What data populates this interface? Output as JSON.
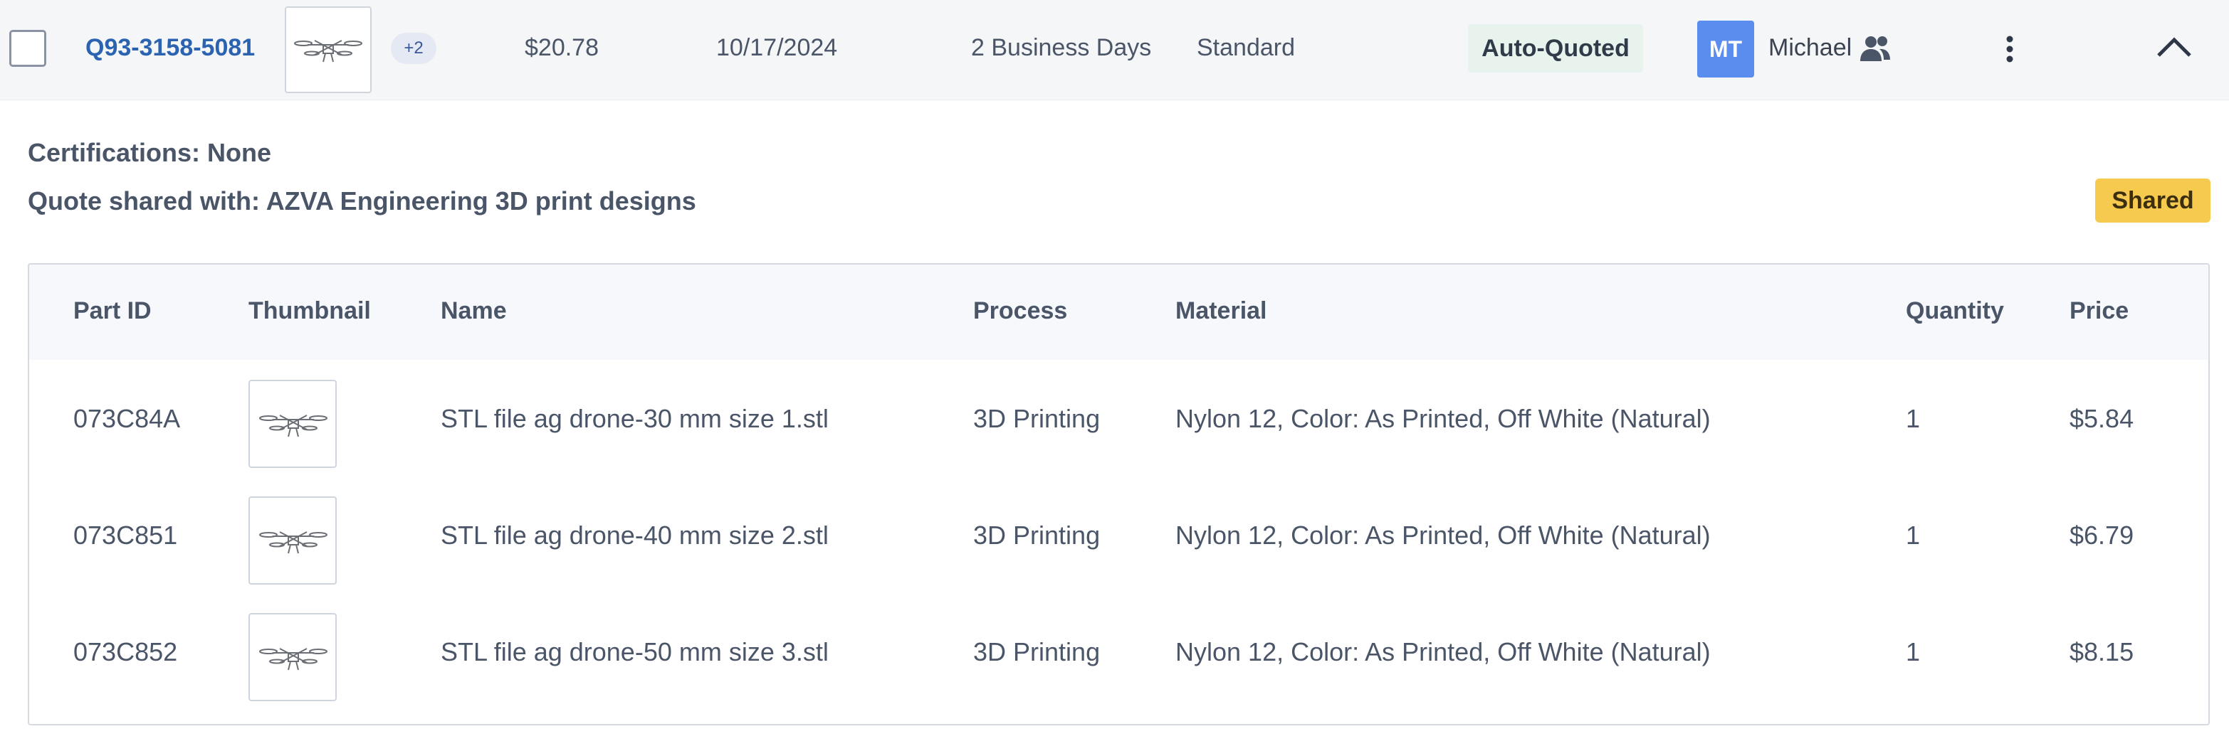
{
  "quote": {
    "id": "Q93-3158-5081",
    "extra_count": "+2",
    "price": "$20.78",
    "date": "10/17/2024",
    "lead_time": "2 Business Days",
    "shipping": "Standard",
    "status": "Auto-Quoted",
    "owner_initials": "MT",
    "owner_name": "Michael"
  },
  "details": {
    "certifications": "Certifications: None",
    "shared_with": "Quote shared with: AZVA Engineering 3D print designs",
    "shared_badge": "Shared"
  },
  "table": {
    "headers": {
      "part_id": "Part ID",
      "thumbnail": "Thumbnail",
      "name": "Name",
      "process": "Process",
      "material": "Material",
      "quantity": "Quantity",
      "price": "Price"
    },
    "rows": [
      {
        "part_id": "073C84A",
        "name": "STL file ag drone-30 mm size 1.stl",
        "process": "3D Printing",
        "material": "Nylon 12, Color: As Printed, Off White (Natural)",
        "quantity": "1",
        "price": "$5.84"
      },
      {
        "part_id": "073C851",
        "name": "STL file ag drone-40 mm size 2.stl",
        "process": "3D Printing",
        "material": "Nylon 12, Color: As Printed, Off White (Natural)",
        "quantity": "1",
        "price": "$6.79"
      },
      {
        "part_id": "073C852",
        "name": "STL file ag drone-50 mm size 3.stl",
        "process": "3D Printing",
        "material": "Nylon 12, Color: As Printed, Off White (Natural)",
        "quantity": "1",
        "price": "$8.15"
      }
    ]
  },
  "icons": {
    "team": "team-icon",
    "menu": "kebab-menu-icon",
    "collapse": "chevron-up-icon",
    "part": "drone-part-icon"
  },
  "colors": {
    "link": "#2c63b0",
    "avatar": "#5b8def",
    "shared_badge": "#f6c94f",
    "status_bg": "#e9f3ee"
  }
}
